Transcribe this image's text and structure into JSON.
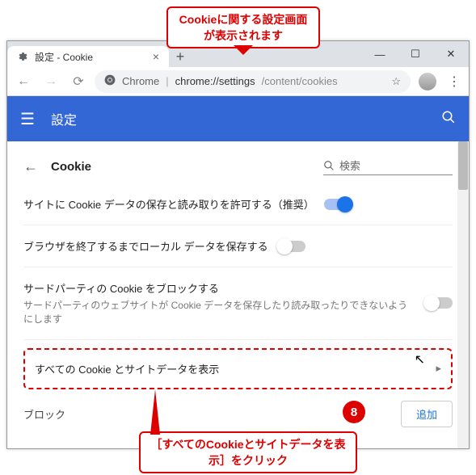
{
  "callouts": {
    "top": "Cookieに関する設定画面が表示されます",
    "bottom": "［すべてのCookieとサイトデータを表示］をクリック",
    "badge": "8"
  },
  "window": {
    "tab_title": "設定 - Cookie",
    "minimize": "—",
    "maximize": "☐",
    "close": "✕"
  },
  "omnibox": {
    "chrome_label": "Chrome",
    "url_main": "chrome://settings",
    "url_rest": "/content/cookies"
  },
  "appbar": {
    "title": "設定"
  },
  "page": {
    "back": "←",
    "heading": "Cookie",
    "search_placeholder": "検索"
  },
  "settings": [
    {
      "title": "サイトに Cookie データの保存と読み取りを許可する（推奨）",
      "sub": "",
      "on": true
    },
    {
      "title": "ブラウザを終了するまでローカル データを保存する",
      "sub": "",
      "on": false
    },
    {
      "title": "サードパーティの Cookie をブロックする",
      "sub": "サードパーティのウェブサイトが Cookie データを保存したり読み取ったりできないようにします",
      "on": false
    }
  ],
  "all_cookies_row": "すべての Cookie とサイトデータを表示",
  "block_section": {
    "label": "ブロック",
    "add": "追加"
  }
}
